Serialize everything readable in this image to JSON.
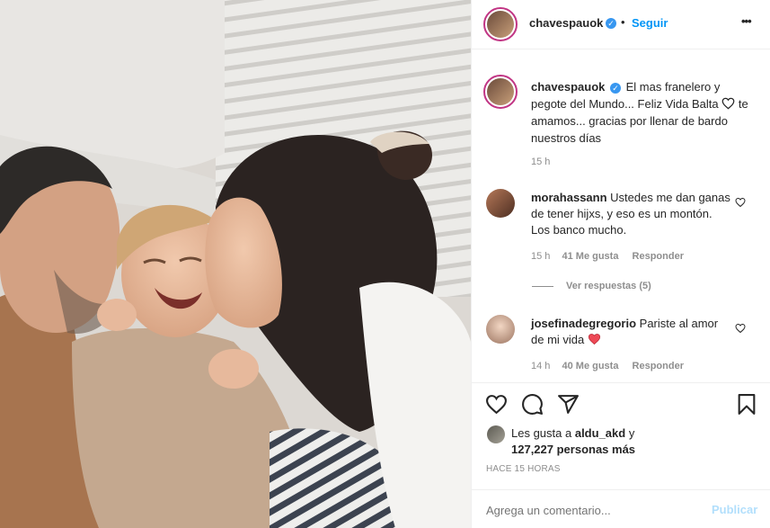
{
  "post": {
    "author": "chavespauok",
    "follow_label": "Seguir",
    "more_label": "•••"
  },
  "caption": {
    "user": "chavespauok",
    "text_part1": "El mas franelero y pegote del Mundo... Feliz Vida Balta",
    "text_part2": "te amamos... gracias por llenar de bardo nuestros días",
    "time": "15 h"
  },
  "comments": [
    {
      "user": "morahassann",
      "text": "Ustedes me dan ganas de tener hijxs, y eso es un montón. Los banco mucho.",
      "time": "15 h",
      "likes": "41 Me gusta",
      "reply_label": "Responder",
      "view_replies": "Ver respuestas (5)"
    },
    {
      "user": "josefinadegregorio",
      "text": "Pariste al amor de mi vida",
      "time": "14 h",
      "likes": "40 Me gusta",
      "reply_label": "Responder"
    }
  ],
  "likes": {
    "prefix": "Les gusta a",
    "user": "aldu_akd",
    "joiner": "y",
    "count": "127,227 personas más"
  },
  "posted_ago": "HACE 15 HORAS",
  "add_comment": {
    "placeholder": "Agrega un comentario...",
    "publish_label": "Publicar"
  },
  "colors": {
    "accent": "#0095f6",
    "publish_disabled": "#b2dffc",
    "heart_red": "#ed4956"
  }
}
